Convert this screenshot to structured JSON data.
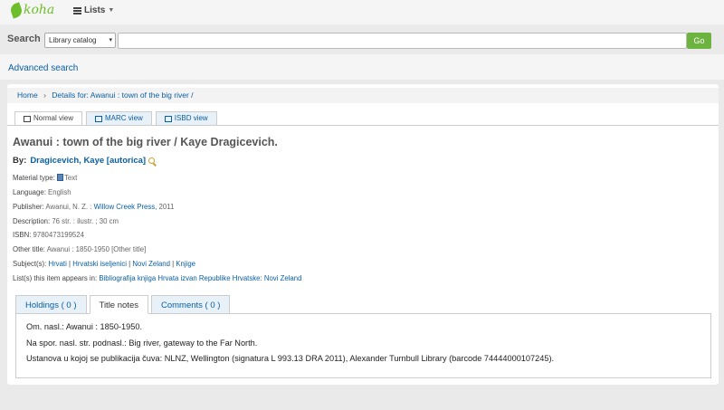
{
  "app": {
    "logo_text": "koha",
    "lists_label": "Lists"
  },
  "search": {
    "label": "Search",
    "scope": "Library catalog",
    "query": "",
    "go_label": "Go"
  },
  "advanced_search": "Advanced search",
  "breadcrumb": {
    "home": "Home",
    "sep": "›",
    "current": "Details for: Awanui : town of the big river /"
  },
  "view_tabs": [
    "Normal view",
    "MARC view",
    "ISBD view"
  ],
  "record": {
    "title": "Awanui : town of the big river / Kaye Dragicevich.",
    "by_label": "By:",
    "author": "Dragicevich, Kaye [autorica]",
    "material_type_label": "Material type:",
    "material_type": "Text",
    "language_label": "Language:",
    "language": "English",
    "publisher_label": "Publisher:",
    "publisher_place": "Awanui, N. Z. :",
    "publisher_name": "Willow Creek Press,",
    "publisher_year": "2011",
    "description_label": "Description:",
    "description": "76 str. : ilustr. ; 30 cm",
    "isbn_label": "ISBN:",
    "isbn": "9780473199524",
    "other_title_label": "Other title:",
    "other_title": "Awanui : 1850-1950 [Other title]",
    "subjects_label": "Subject(s):",
    "subjects": [
      "Hrvati",
      "Hrvatski iseljenici",
      "Novi Zeland",
      "Knjige"
    ],
    "subject_sep": "|",
    "lists_label": "List(s) this item appears in:",
    "lists": [
      "Bibliografija knjiga Hrvata izvan Republike Hrvatske",
      "Novi Zeland"
    ],
    "lists_sep": ":"
  },
  "notes_tabs": [
    "Holdings ( 0 )",
    "Title notes",
    "Comments ( 0 )"
  ],
  "notes": [
    "Om. nasl.: Awanui : 1850-1950.",
    "Na spor. nasl. str. podnasl.: Big river, gateway to the Far North.",
    "Ustanova u kojoj se publikacija čuva: NLNZ, Wellington (signatura L 993.13 DRA 2011), Alexander Turnbull Library (barcode 74444000107245)."
  ],
  "colors": {
    "link": "#0a5fa3",
    "brand": "#6cbf2a",
    "go": "#6cb33f"
  }
}
